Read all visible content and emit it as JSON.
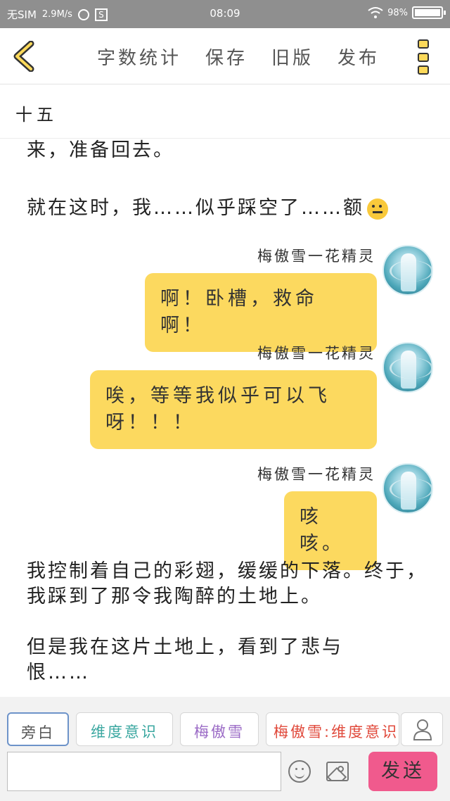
{
  "status_bar": {
    "carrier": "无SIM",
    "speed": "2.9M/s",
    "app_badge": "S",
    "time": "08:09",
    "battery": "98%"
  },
  "toolbar": {
    "items": [
      "字数统计",
      "保存",
      "旧版",
      "发布"
    ]
  },
  "chapter": {
    "title": "十五"
  },
  "content": {
    "partial_line": "来，准备回去。",
    "para1": "就在这时，我……似乎踩空了……额",
    "messages": [
      {
        "speaker": "梅傲雪一花精灵",
        "text": "啊！卧槽，救命啊！"
      },
      {
        "speaker": "梅傲雪一花精灵",
        "text": "唉，等等我似乎可以飞呀！！！"
      },
      {
        "speaker": "梅傲雪一花精灵",
        "text": "咳咳。"
      }
    ],
    "para2": "我控制着自己的彩翅，缓缓的下落。终于，我踩到了那令我陶醉的土地上。",
    "para3": "但是我在这片土地上，看到了悲与恨……"
  },
  "bottom": {
    "roles": [
      {
        "label": "旁白",
        "color": "#555555"
      },
      {
        "label": "维度意识",
        "color": "#3aa7a0"
      },
      {
        "label": "梅傲雪",
        "color": "#9b6bc6"
      },
      {
        "label": "梅傲雪:维度意识",
        "color": "#e0483a"
      }
    ],
    "send_label": "发送"
  },
  "colors": {
    "bubble": "#fcd95f",
    "send": "#f05a8d",
    "status_bar": "#8f8f8f"
  }
}
